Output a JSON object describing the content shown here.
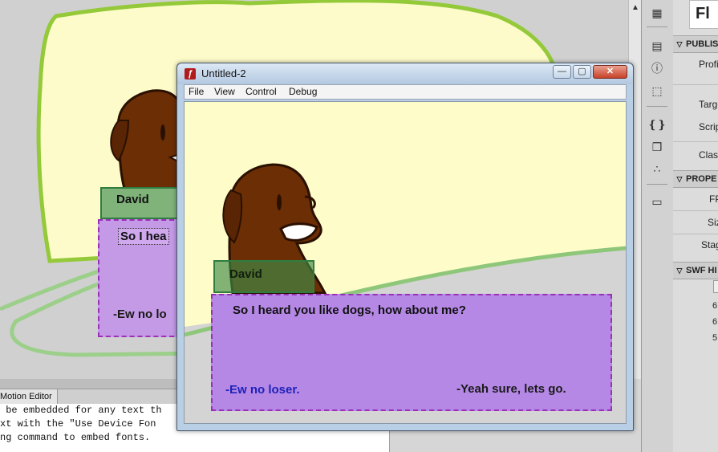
{
  "authoring": {
    "character_name": "David",
    "dialog_line_partial": "So I hea",
    "option_partial": "-Ew no lo"
  },
  "panel": {
    "tab_label": "Motion Editor",
    "output_lines": [
      " be embedded for any text th",
      "xt with the \"Use Device Fon",
      "ng command to embed fonts."
    ]
  },
  "properties": {
    "logo": "Fl",
    "publish_header": "PUBLISH",
    "profile_label": "Profi",
    "target_label": "Targe",
    "script_label": "Scrip",
    "class_label": "Clas",
    "properties_header": "PROPE",
    "fps_label": "FP",
    "size_label": "Siz",
    "stage_label": "Stag",
    "swf_header": "SWF HI",
    "swf_numbers": [
      "6",
      "6",
      "5"
    ]
  },
  "player": {
    "title": "Untitled-2",
    "menu": [
      "File",
      "View",
      "Control",
      "Debug"
    ],
    "character_name": "David",
    "dialog_line": "So I heard you like dogs, how about me?",
    "option_no": "-Ew no loser.",
    "option_yes": "-Yeah sure, lets go."
  },
  "colors": {
    "background_yellow": "#fefcc8",
    "ground_green": "#8ec77a",
    "dog_brown": "#6b2e05",
    "dialog_purple": "#b588e6",
    "name_green": "#408c46",
    "option_blue": "#1f22b8"
  },
  "icons": {
    "app": "flash-player-icon",
    "tools": [
      "grid-icon",
      "align-icon",
      "info-icon",
      "transform-icon",
      "code-snippets-icon",
      "components-icon",
      "motion-presets-icon",
      "library-icon"
    ]
  }
}
